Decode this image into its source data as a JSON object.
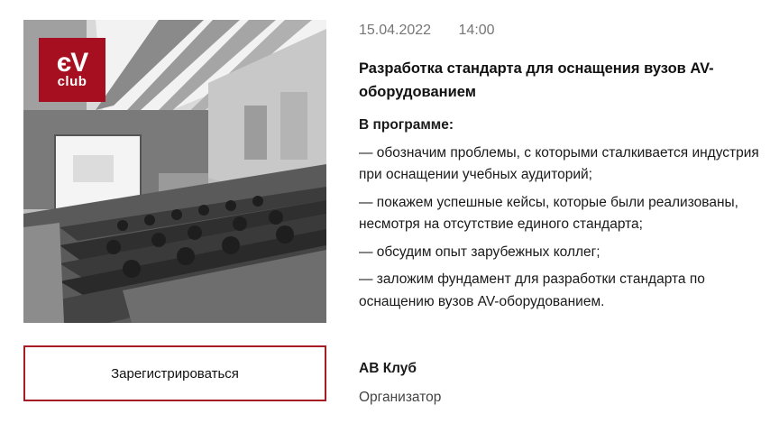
{
  "event": {
    "date": "15.04.2022",
    "time": "14:00",
    "title": "Разработка стандарта для оснащения вузов AV-оборудованием",
    "program_heading": "В программе:",
    "program_items": [
      "— обозначим проблемы, с которыми сталкивается индустрия при оснащении учебных аудиторий;",
      "— покажем успешные кейсы, которые были реализованы, несмотря на отсутствие единого стандарта;",
      "— обсудим опыт зарубежных коллег;",
      "— заложим фундамент для разработки стандарта по оснащению вузов AV-оборудованием."
    ],
    "organizer_name": "АВ Клуб",
    "organizer_role": "Организатор"
  },
  "logo": {
    "line1": "єV",
    "line2": "club"
  },
  "actions": {
    "register_label": "Зарегистрироваться"
  },
  "colors": {
    "brand": "#a50f1f",
    "button_border": "#a51c25",
    "meta_text": "#767676"
  }
}
